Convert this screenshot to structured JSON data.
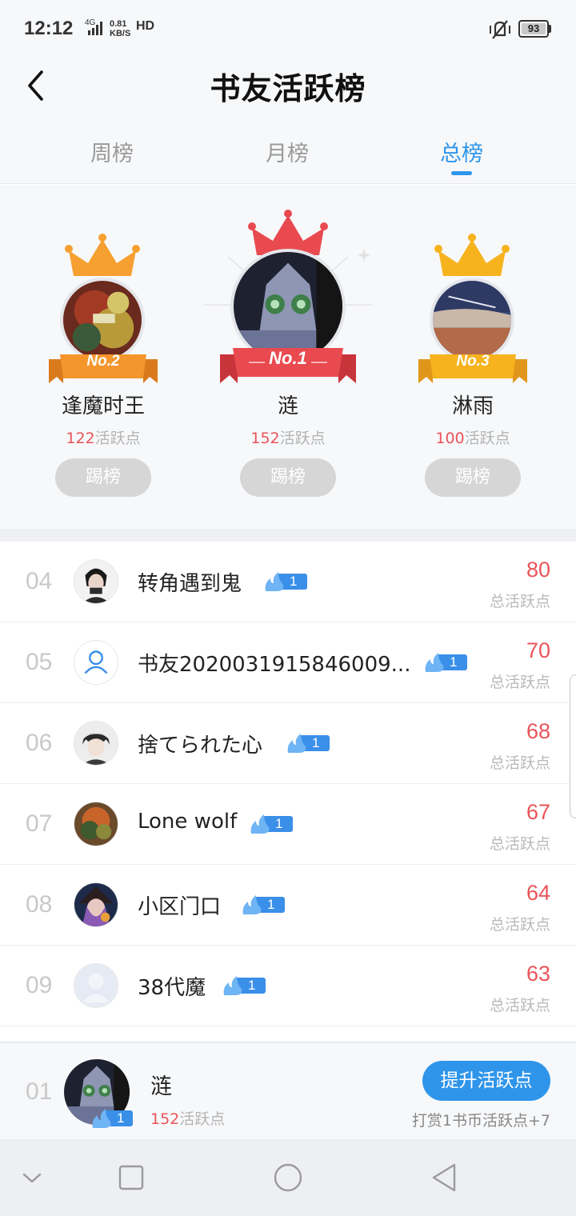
{
  "status_bar": {
    "time": "12:12",
    "network": "4G",
    "speed_value": "0.81",
    "speed_unit": "KB/S",
    "hd": "HD",
    "battery": "93"
  },
  "header": {
    "title": "书友活跃榜"
  },
  "tabs": [
    {
      "label": "周榜",
      "active": false
    },
    {
      "label": "月榜",
      "active": false
    },
    {
      "label": "总榜",
      "active": true
    }
  ],
  "podium": [
    {
      "rank_label": "No.1",
      "name": "涟",
      "score": "152",
      "score_unit": "活跃点",
      "button": "踢榜"
    },
    {
      "rank_label": "No.2",
      "name": "逢魔时王",
      "score": "122",
      "score_unit": "活跃点",
      "button": "踢榜"
    },
    {
      "rank_label": "No.3",
      "name": "淋雨",
      "score": "100",
      "score_unit": "活跃点",
      "button": "踢榜"
    }
  ],
  "ranking": [
    {
      "rank": "04",
      "name": "转角遇到鬼",
      "level": "1",
      "score": "80",
      "score_label": "总活跃点"
    },
    {
      "rank": "05",
      "name": "书友2020031915846009...",
      "level": "1",
      "score": "70",
      "score_label": "总活跃点"
    },
    {
      "rank": "06",
      "name": "捨てられた心",
      "level": "1",
      "score": "68",
      "score_label": "总活跃点"
    },
    {
      "rank": "07",
      "name": "Lone wolf",
      "level": "1",
      "score": "67",
      "score_label": "总活跃点"
    },
    {
      "rank": "08",
      "name": "小区门口",
      "level": "1",
      "score": "64",
      "score_label": "总活跃点"
    },
    {
      "rank": "09",
      "name": "38代魔",
      "level": "1",
      "score": "63",
      "score_label": "总活跃点"
    }
  ],
  "me": {
    "rank": "01",
    "name": "涟",
    "level": "1",
    "score": "152",
    "score_unit": "活跃点",
    "button": "提升活跃点",
    "hint": "打赏1书币活跃点+7"
  },
  "colors": {
    "accent": "#2f95ea",
    "score_red": "#e9545a",
    "crown_red": "#e84a4f",
    "crown_orange": "#f5a030",
    "crown_gold": "#f6b31e"
  }
}
